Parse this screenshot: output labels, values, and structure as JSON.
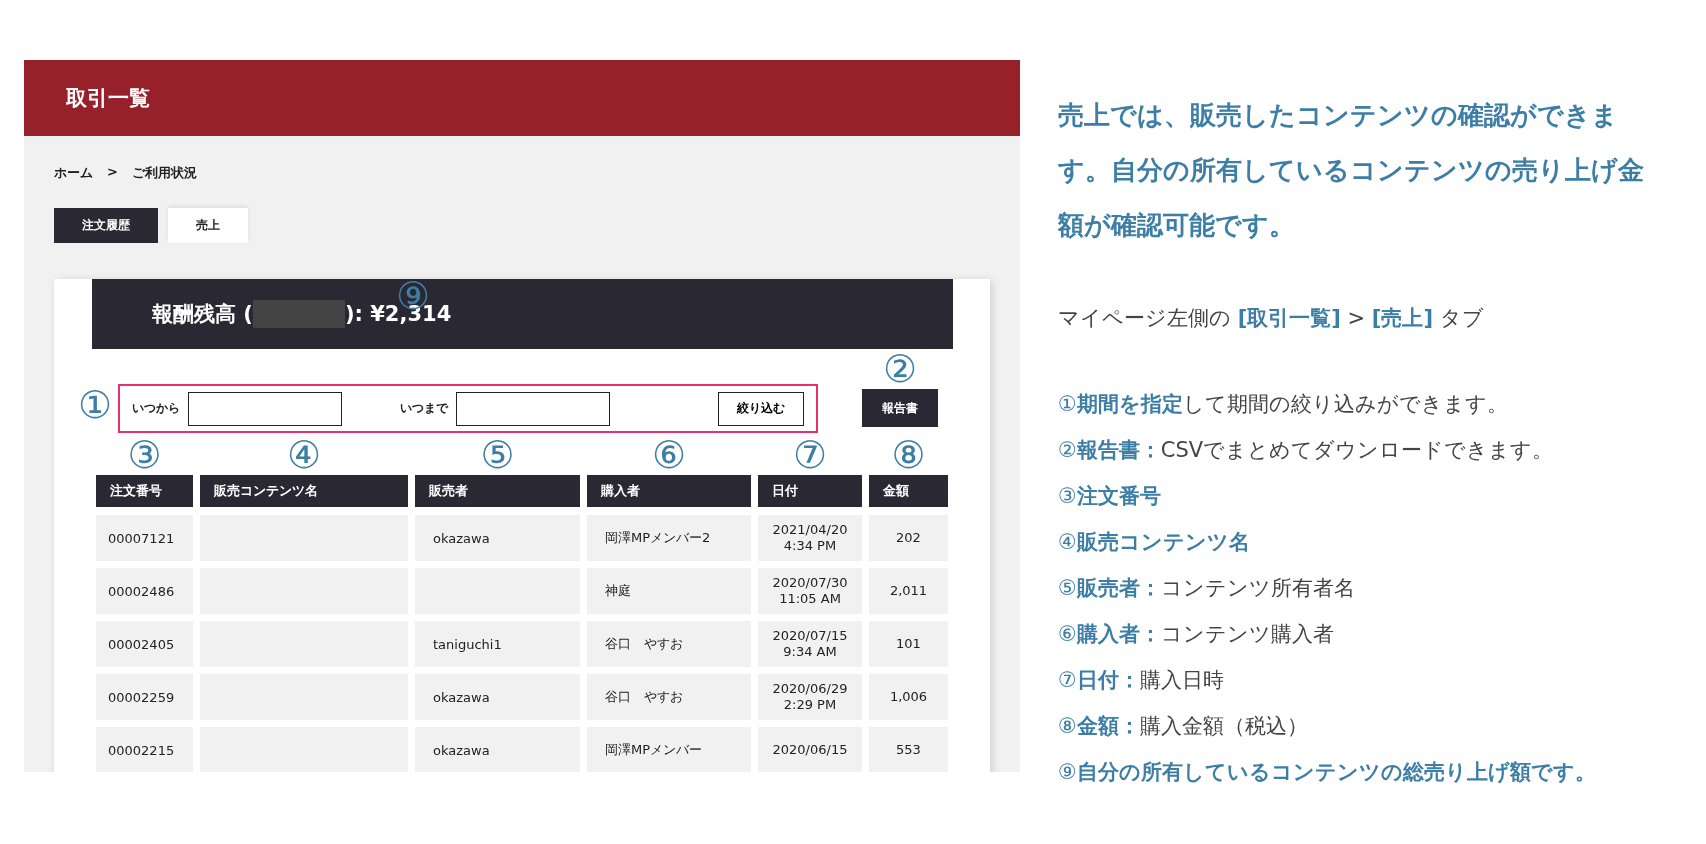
{
  "panel": {
    "title": "取引一覧",
    "breadcrumb": [
      "ホーム",
      ">",
      "ご利用状況"
    ],
    "tabs": [
      {
        "label": "注文履歴",
        "selected": false
      },
      {
        "label": "売上",
        "selected": true
      }
    ],
    "balance": {
      "marker": "⑨",
      "prefix": "報酬残高 (",
      "suffix": "): ¥2,314"
    },
    "filter": {
      "marker": "①",
      "from_label": "いつから",
      "to_label": "いつまで",
      "button": "絞り込む"
    },
    "report": {
      "marker": "②",
      "button": "報告書"
    },
    "table": {
      "columns": [
        {
          "marker": "③",
          "label": "注文番号"
        },
        {
          "marker": "④",
          "label": "販売コンテンツ名"
        },
        {
          "marker": "⑤",
          "label": "販売者"
        },
        {
          "marker": "⑥",
          "label": "購入者"
        },
        {
          "marker": "⑦",
          "label": "日付"
        },
        {
          "marker": "⑧",
          "label": "金額"
        }
      ],
      "rows": [
        {
          "order_no": "00007121",
          "seller": "okazawa",
          "buyer": "岡澤MPメンバー2",
          "date": "2021/04/20",
          "time": "4:34 PM",
          "amount": "202"
        },
        {
          "order_no": "00002486",
          "buyer": "神庭",
          "date": "2020/07/30",
          "time": "11:05 AM",
          "amount": "2,011"
        },
        {
          "order_no": "00002405",
          "seller": "taniguchi1",
          "buyer": "谷口　やすお",
          "date": "2020/07/15",
          "time": "9:34 AM",
          "amount": "101"
        },
        {
          "order_no": "00002259",
          "seller": "okazawa",
          "buyer": "谷口　やすお",
          "date": "2020/06/29",
          "time": "2:29 PM",
          "amount": "1,006"
        },
        {
          "order_no": "00002215",
          "seller": "okazawa",
          "buyer": "岡澤MPメンバー",
          "date": "2020/06/15",
          "amount": "553"
        }
      ]
    }
  },
  "explanation": {
    "heading": "売上では、販売したコンテンツの確認ができます。自分の所有しているコンテンツの売り上げ金額が確認可能です。",
    "path": "マイページ左側の **[取引一覧]** > **[売上]** タブ",
    "items": [
      {
        "marker": "①",
        "term": "期間を指定",
        "text": "して期間の絞り込みができます。"
      },
      {
        "marker": "②",
        "term": "報告書：",
        "text": "CSVでまとめてダウンロードできます。"
      },
      {
        "marker": "③",
        "term": "注文番号"
      },
      {
        "marker": "④",
        "term": "販売コンテンツ名"
      },
      {
        "marker": "⑤",
        "term": "販売者：",
        "text": "コンテンツ所有者名"
      },
      {
        "marker": "⑥",
        "term": "購入者：",
        "text": "コンテンツ購入者"
      },
      {
        "marker": "⑦",
        "term": "日付：",
        "text": "購入日時"
      },
      {
        "marker": "⑧",
        "term": "金額：",
        "text": "購入金額（税込）"
      },
      {
        "marker": "⑨",
        "term": "自分の所有しているコンテンツの総売り上げ額です。"
      }
    ]
  }
}
